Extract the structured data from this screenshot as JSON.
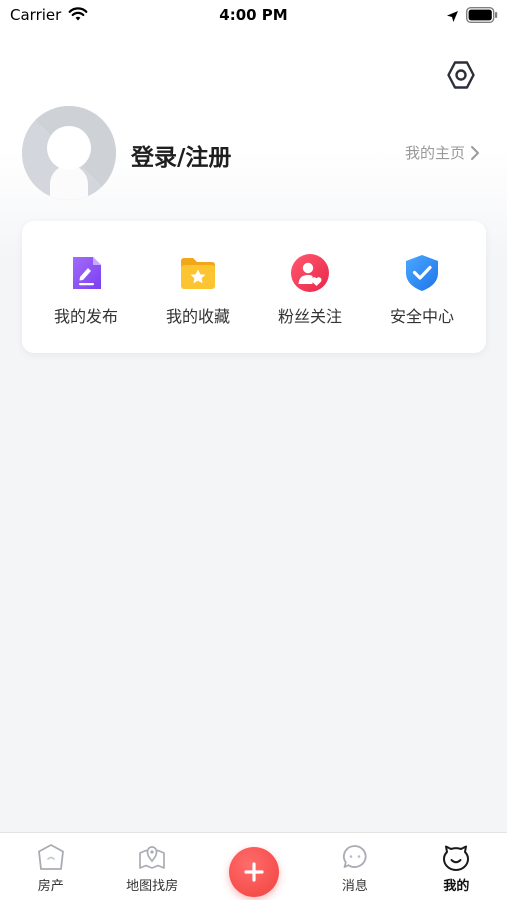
{
  "status_bar": {
    "carrier": "Carrier",
    "time": "4:00 PM"
  },
  "profile": {
    "login_label": "登录/注册",
    "homepage_label": "我的主页"
  },
  "quick_actions": [
    {
      "label": "我的发布",
      "icon": "edit-document-icon",
      "color": "#8b5cf6"
    },
    {
      "label": "我的收藏",
      "icon": "star-folder-icon",
      "color": "#f9b81e"
    },
    {
      "label": "粉丝关注",
      "icon": "user-heart-icon",
      "color": "#f0405a"
    },
    {
      "label": "安全中心",
      "icon": "shield-check-icon",
      "color": "#2f8af5"
    }
  ],
  "tab_bar": {
    "items": [
      {
        "label": "房产",
        "icon": "house-icon"
      },
      {
        "label": "地图找房",
        "icon": "map-pin-icon"
      },
      {
        "label": "",
        "icon": "plus-icon"
      },
      {
        "label": "消息",
        "icon": "message-icon"
      },
      {
        "label": "我的",
        "icon": "smile-icon"
      }
    ],
    "active_index": 4,
    "accent_color": "#f1423f"
  }
}
